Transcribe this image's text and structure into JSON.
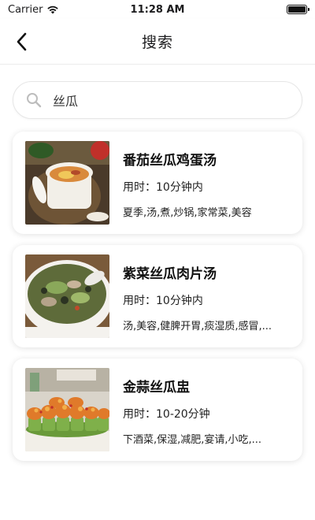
{
  "status_bar": {
    "carrier": "Carrier",
    "time": "11:28 AM"
  },
  "nav": {
    "title": "搜索",
    "back_icon": "chevron-left-icon"
  },
  "search": {
    "icon": "search-icon",
    "value": "丝瓜",
    "placeholder": ""
  },
  "results": [
    {
      "title": "番茄丝瓜鸡蛋汤",
      "time_label": "用时：",
      "time_value": "10分钟内",
      "tags": "夏季,汤,煮,炒锅,家常菜,美容",
      "image": "tomato-loofah-egg-soup-photo"
    },
    {
      "title": "紫菜丝瓜肉片汤",
      "time_label": "用时：",
      "time_value": "10分钟内",
      "tags": "汤,美容,健脾开胃,痰湿质,感冒,...",
      "image": "seaweed-loofah-pork-soup-photo"
    },
    {
      "title": "金蒜丝瓜盅",
      "time_label": "用时：",
      "time_value": "10-20分钟",
      "tags": "下酒菜,保湿,减肥,宴请,小吃,...",
      "image": "garlic-loofah-cups-photo"
    }
  ]
}
